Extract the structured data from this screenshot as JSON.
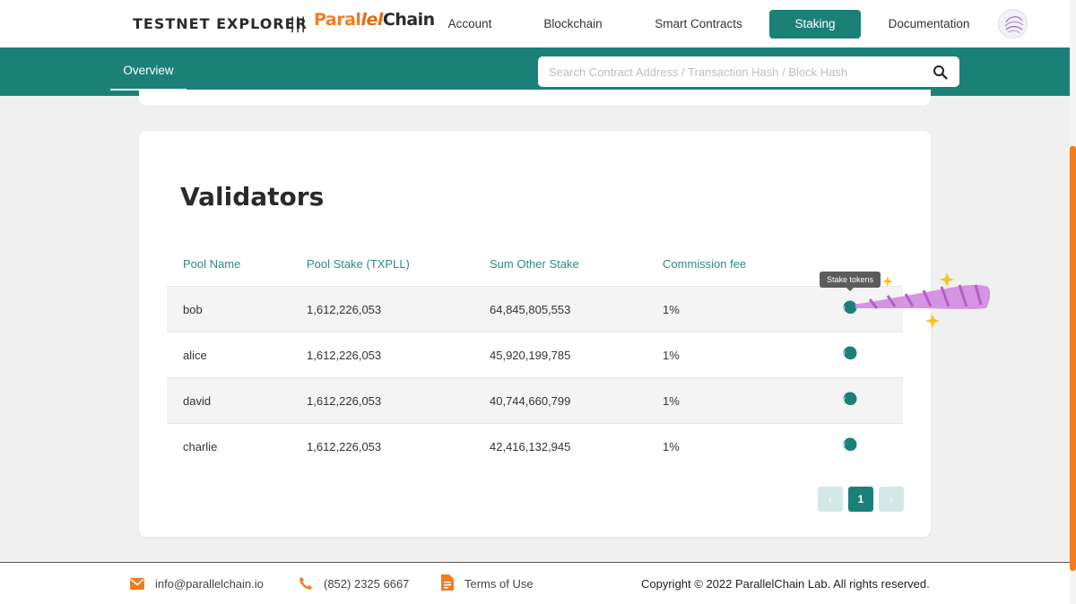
{
  "header": {
    "brand": "TESTNET EXPLORER",
    "separator": "|||",
    "logo": {
      "part1": "Paral",
      "part2": "lel",
      "part3": "Chain"
    },
    "nav": [
      "Account",
      "Blockchain",
      "Smart Contracts",
      "Staking",
      "Documentation"
    ],
    "active_nav": "Staking"
  },
  "subnav": {
    "tab": "Overview",
    "search_placeholder": "Search Contract Address / Transaction Hash / Block Hash"
  },
  "validators": {
    "title": "Validators",
    "columns": [
      "Pool Name",
      "Pool Stake (TXPLL)",
      "Sum Other Stake",
      "Commission fee"
    ],
    "rows": [
      {
        "name": "bob",
        "pool_stake": "1,612,226,053",
        "other_stake": "64,845,805,553",
        "fee": "1%"
      },
      {
        "name": "alice",
        "pool_stake": "1,612,226,053",
        "other_stake": "45,920,199,785",
        "fee": "1%"
      },
      {
        "name": "david",
        "pool_stake": "1,612,226,053",
        "other_stake": "40,744,660,799",
        "fee": "1%"
      },
      {
        "name": "charlie",
        "pool_stake": "1,612,226,053",
        "other_stake": "42,416,132,945",
        "fee": "1%"
      }
    ],
    "tooltip": "Stake tokens",
    "pagination": {
      "prev": "‹",
      "current": "1",
      "next": "›"
    }
  },
  "footer": {
    "email": "info@parallelchain.io",
    "phone": "(852) 2325 6667",
    "terms": "Terms of Use",
    "copyright": "Copyright © 2022 ParallelChain Lab. All rights reserved."
  },
  "colors": {
    "teal": "#1b8178",
    "orange": "#f07d1e",
    "header_text": "#2d8a80",
    "sparkle": "#cc7ad6"
  }
}
